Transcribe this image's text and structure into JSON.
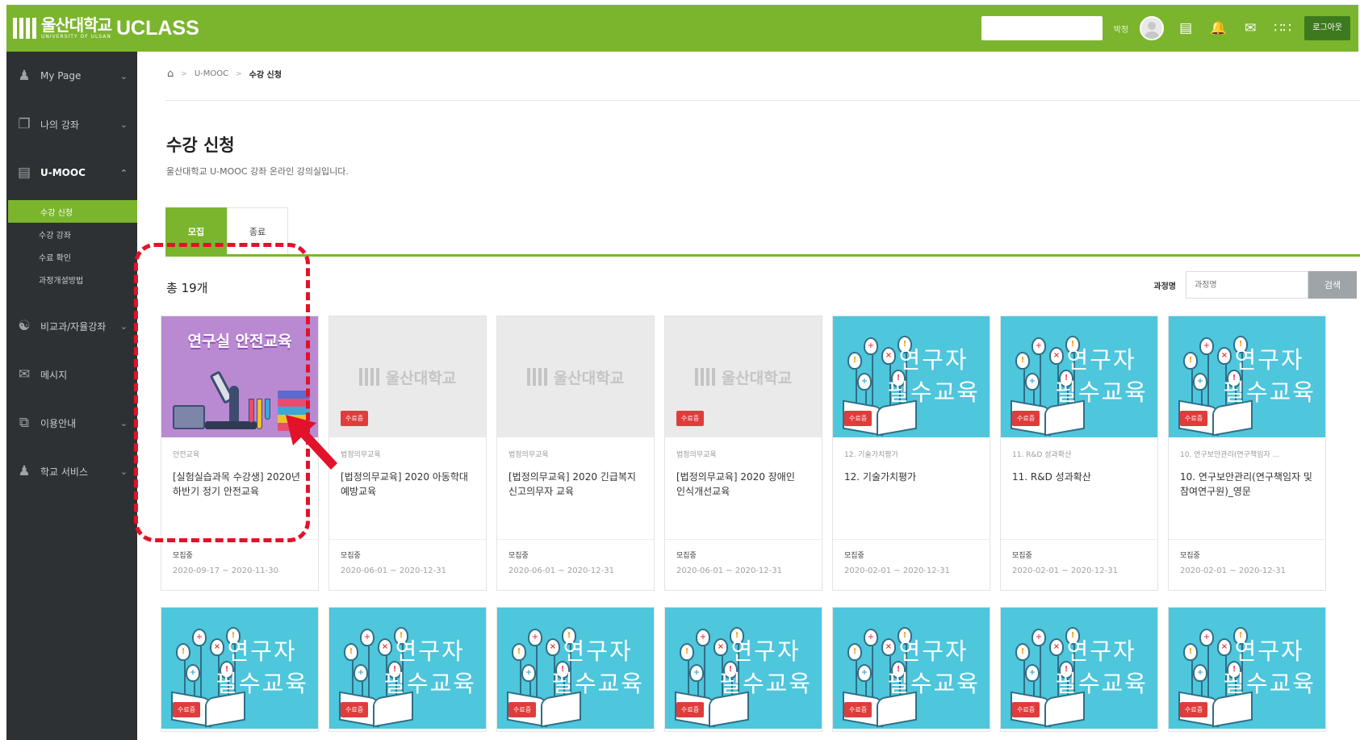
{
  "header": {
    "logo_kor": "울산대학교",
    "logo_eng": "UNIVERSITY OF ULSAN",
    "app_name": "UCLASS",
    "user_name": "박정",
    "logout_label": "로그아웃"
  },
  "sidebar": {
    "items": [
      {
        "label": "My Page",
        "icon": "person-icon"
      },
      {
        "label": "나의 강좌",
        "icon": "book-icon"
      },
      {
        "label": "U-MOOC",
        "icon": "mooc-icon"
      },
      {
        "label": "비교과/자율강좌",
        "icon": "people-icon"
      },
      {
        "label": "메시지",
        "icon": "mail-icon"
      },
      {
        "label": "이용안내",
        "icon": "guide-icon"
      },
      {
        "label": "학교 서비스",
        "icon": "person-icon"
      }
    ],
    "submenu": [
      "수강 신청",
      "수강 강좌",
      "수료 확인",
      "과정개설방법"
    ]
  },
  "breadcrumb": [
    "U-MOOC",
    "수강 신청"
  ],
  "page": {
    "title": "수강 신청",
    "description": "울산대학교 U-MOOC 강좌 온라인 강의실입니다."
  },
  "tabs": [
    "모집",
    "종료"
  ],
  "list": {
    "total": "총 19개",
    "search_label": "과정명",
    "search_placeholder": "과정명",
    "search_button": "검색"
  },
  "thumb_text": {
    "research_line1": "연구자",
    "research_line2": "필수교육",
    "lab_safety": "연구실 안전교육",
    "gray_logo": "울산대학교"
  },
  "cards": [
    {
      "thumb": "purple",
      "badge": "",
      "category": "안전교육",
      "title": "[실험실습과목 수강생] 2020년 하반기 정기 안전교육",
      "status": "모집중",
      "period": "2020-09-17 ~ 2020-11-30"
    },
    {
      "thumb": "gray",
      "badge": "수료증",
      "category": "법정의무교육",
      "title": "[법정의무교육] 2020 아동학대 예방교육",
      "status": "모집중",
      "period": "2020-06-01 ~ 2020-12-31"
    },
    {
      "thumb": "gray",
      "badge": "",
      "category": "법정의무교육",
      "title": "[법정의무교육] 2020 긴급복지 신고의무자 교육",
      "status": "모집중",
      "period": "2020-06-01 ~ 2020-12-31"
    },
    {
      "thumb": "gray",
      "badge": "수료증",
      "category": "법정의무교육",
      "title": "[법정의무교육] 2020 장애인 인식개선교육",
      "status": "모집중",
      "period": "2020-06-01 ~ 2020-12-31"
    },
    {
      "thumb": "cyan",
      "badge": "수료증",
      "category": "12. 기술가치평가",
      "title": "12. 기술가치평가",
      "status": "모집중",
      "period": "2020-02-01 ~ 2020-12-31"
    },
    {
      "thumb": "cyan",
      "badge": "수료증",
      "category": "11. R&D 성과확산",
      "title": "11. R&D 성과확산",
      "status": "모집중",
      "period": "2020-02-01 ~ 2020-12-31"
    },
    {
      "thumb": "cyan",
      "badge": "수료증",
      "category": "10. 연구보안관리(연구책임자 ...",
      "title": "10. 연구보안관리(연구책임자 및 참여연구원)_영문",
      "status": "모집중",
      "period": "2020-02-01 ~ 2020-12-31"
    }
  ],
  "cards_row2_badge": "수료증",
  "colors": {
    "brand_green": "#7bb52e",
    "sidebar_bg": "#2d3133",
    "badge_red": "#e03c3c",
    "highlight_red": "#e2122a",
    "thumb_cyan": "#4ec6dc",
    "thumb_purple": "#b98ad2"
  }
}
